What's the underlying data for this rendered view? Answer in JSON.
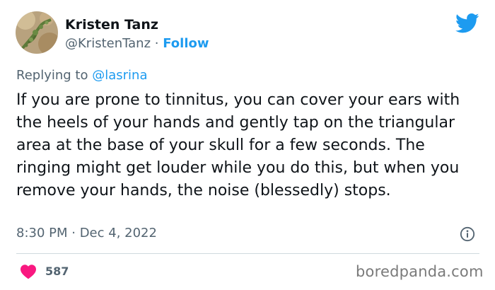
{
  "author": {
    "name": "Kristen Tanz",
    "handle": "@KristenTanz",
    "separator": "·",
    "follow_label": "Follow"
  },
  "reply": {
    "prefix": "Replying to",
    "mention": "@lasrina"
  },
  "tweet": {
    "text": "If you are prone to tinnitus, you can cover your ears with the heels of your hands and gently tap on the triangular area at the base of your skull for a few seconds. The ringing might get louder while you do this, but when you remove your hands, the noise (blessedly) stops.",
    "timestamp": "8:30 PM · Dec 4, 2022"
  },
  "engagement": {
    "like_count": "587"
  },
  "watermark": "boredpanda.com",
  "icons": {
    "logo": "twitter-bird-icon",
    "info": "info-icon",
    "like": "heart-icon"
  },
  "colors": {
    "accent": "#1d9bf0",
    "like": "#f91880",
    "text_primary": "#0f1419",
    "text_secondary": "#536471"
  }
}
